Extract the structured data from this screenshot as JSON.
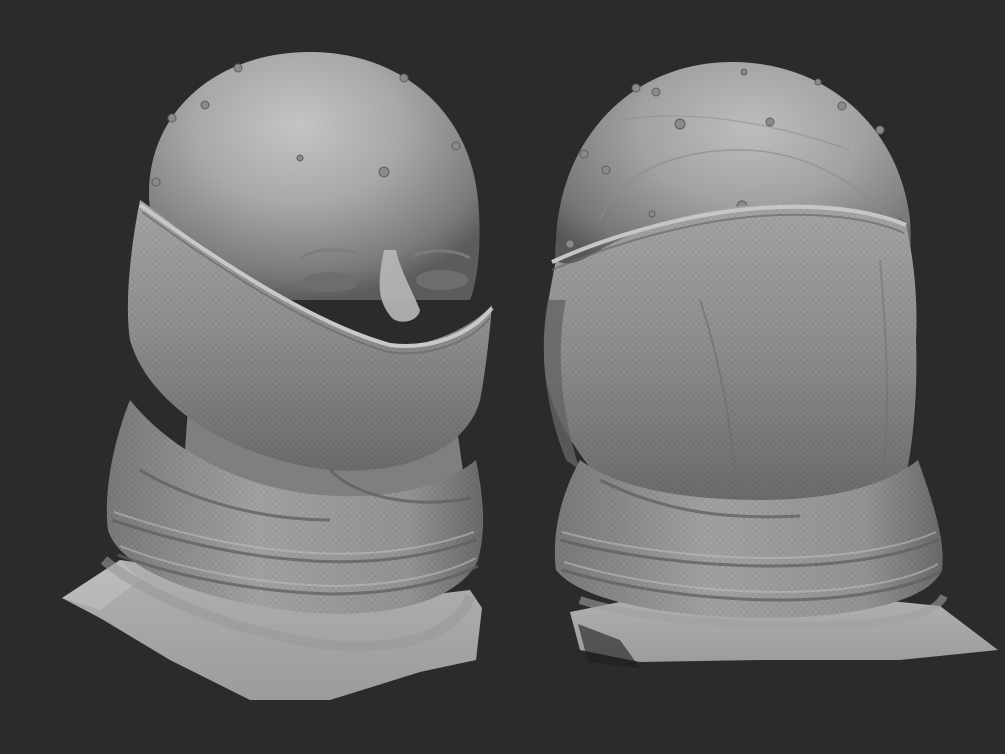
{
  "scene": {
    "background_color": "#2b2b2b",
    "model_color": "#a9a9a9",
    "models": [
      {
        "name": "front-three-quarter-view",
        "subject": "head-with-neck-gaiter"
      },
      {
        "name": "back-three-quarter-view",
        "subject": "head-with-neck-gaiter"
      }
    ]
  }
}
